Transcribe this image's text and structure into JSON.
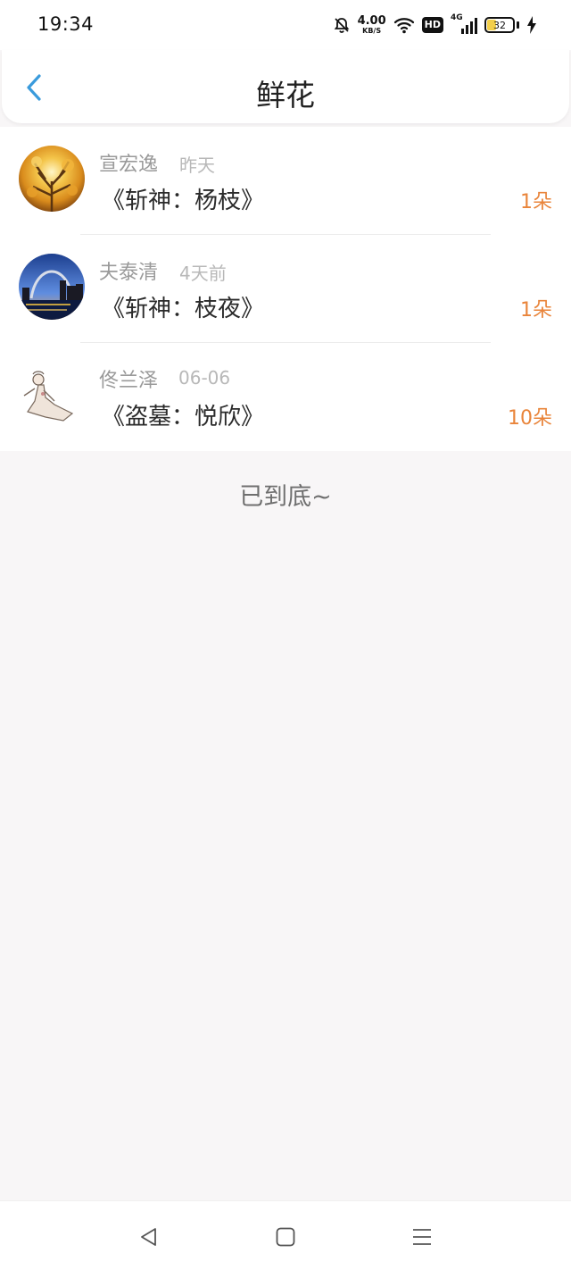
{
  "status_bar": {
    "time": "19:34",
    "net_speed_value": "4.00",
    "net_speed_unit": "KB/S",
    "hd_label": "HD",
    "signal_label": "4G",
    "battery_level": "32",
    "icons": [
      "bell-off-icon",
      "wifi-icon",
      "hd-icon",
      "signal-icon",
      "battery-icon",
      "charging-icon"
    ]
  },
  "header": {
    "title": "鲜花",
    "back_icon": "chevron-left-icon",
    "accent_color": "#3a9bdc"
  },
  "flowers": [
    {
      "user": "宣宏逸",
      "time": "昨天",
      "book": "《斩神：杨枝》",
      "count": "1朵",
      "avatar": "golden-tree-avatar"
    },
    {
      "user": "夫泰清",
      "time": "4天前",
      "book": "《斩神：枝夜》",
      "count": "1朵",
      "avatar": "city-arch-avatar"
    },
    {
      "user": "佟兰泽",
      "time": "06-06",
      "book": "《盗墓：悦欣》",
      "count": "10朵",
      "avatar": "anime-girl-avatar"
    }
  ],
  "colors": {
    "count": "#e9843a",
    "background": "#f8f6f7"
  },
  "end_text": "已到底~",
  "nav_bar": {
    "icons": [
      "back-triangle-icon",
      "home-square-icon",
      "menu-lines-icon"
    ]
  }
}
